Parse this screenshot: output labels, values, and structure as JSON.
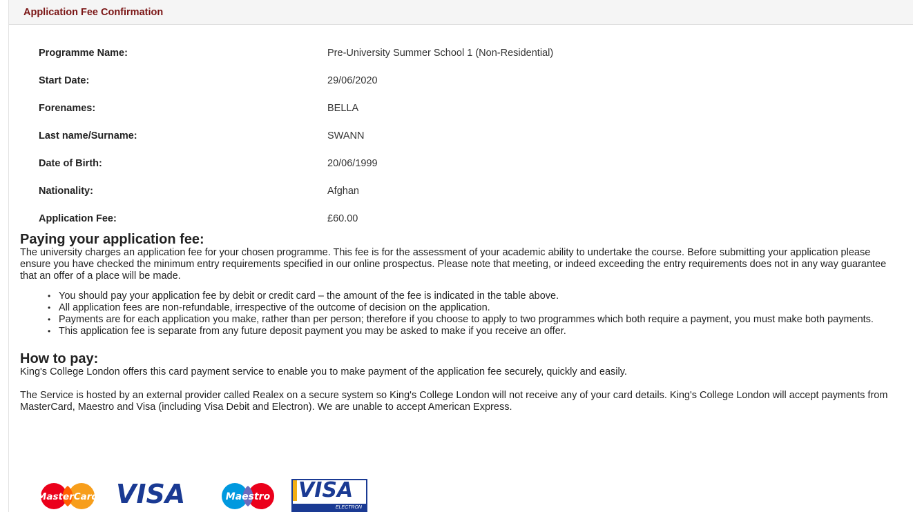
{
  "panel": {
    "title": "Application Fee Confirmation"
  },
  "details": [
    {
      "label": "Programme Name:",
      "value": "Pre-University Summer School 1 (Non-Residential)"
    },
    {
      "label": "Start Date:",
      "value": "29/06/2020"
    },
    {
      "label": "Forenames:",
      "value": "BELLA"
    },
    {
      "label": "Last name/Surname:",
      "value": "SWANN"
    },
    {
      "label": "Date of Birth:",
      "value": "20/06/1999"
    },
    {
      "label": "Nationality:",
      "value": "Afghan"
    },
    {
      "label": "Application Fee:",
      "value": "£60.00"
    }
  ],
  "paying": {
    "heading": "Paying your application fee:",
    "intro": "The university charges an application fee for your chosen programme. This fee is for the assessment of your academic ability to undertake the course. Before submitting your application please ensure you have checked the minimum entry requirements specified in our online prospectus. Please note that meeting, or indeed exceeding the entry requirements does not in any way guarantee that an offer of a place will be made.",
    "bullets": [
      "You should pay your application fee by debit or credit card – the amount of the fee is indicated in the table above.",
      "All application fees are non-refundable, irrespective of the outcome of decision on the application.",
      "Payments are for each application you make, rather than per person; therefore if you choose to apply to two programmes which both require a payment, you must make both payments.",
      "This application fee is separate from any future deposit payment you may be asked to make if you receive an offer."
    ]
  },
  "how": {
    "heading": "How to pay:",
    "para1": "King's College London offers this card payment service to enable you to make payment of the application fee securely, quickly and easily.",
    "para2": "The Service is hosted by an external provider called Realex on a secure system so King's College London will not receive any of your card details. King's College London will accept payments from MasterCard, Maestro and Visa (including Visa Debit and Electron). We are unable to accept American Express."
  },
  "cards": {
    "mastercard": "MasterCard",
    "visa": "VISA",
    "maestro": "Maestro",
    "visa_electron": "VISA",
    "electron": "ELECTRON"
  },
  "colors": {
    "header_title": "#7a1515",
    "visa_blue": "#1a3a93",
    "mc_red": "#eb001b",
    "mc_orange": "#f79e1b",
    "maestro_blue": "#0099df"
  }
}
